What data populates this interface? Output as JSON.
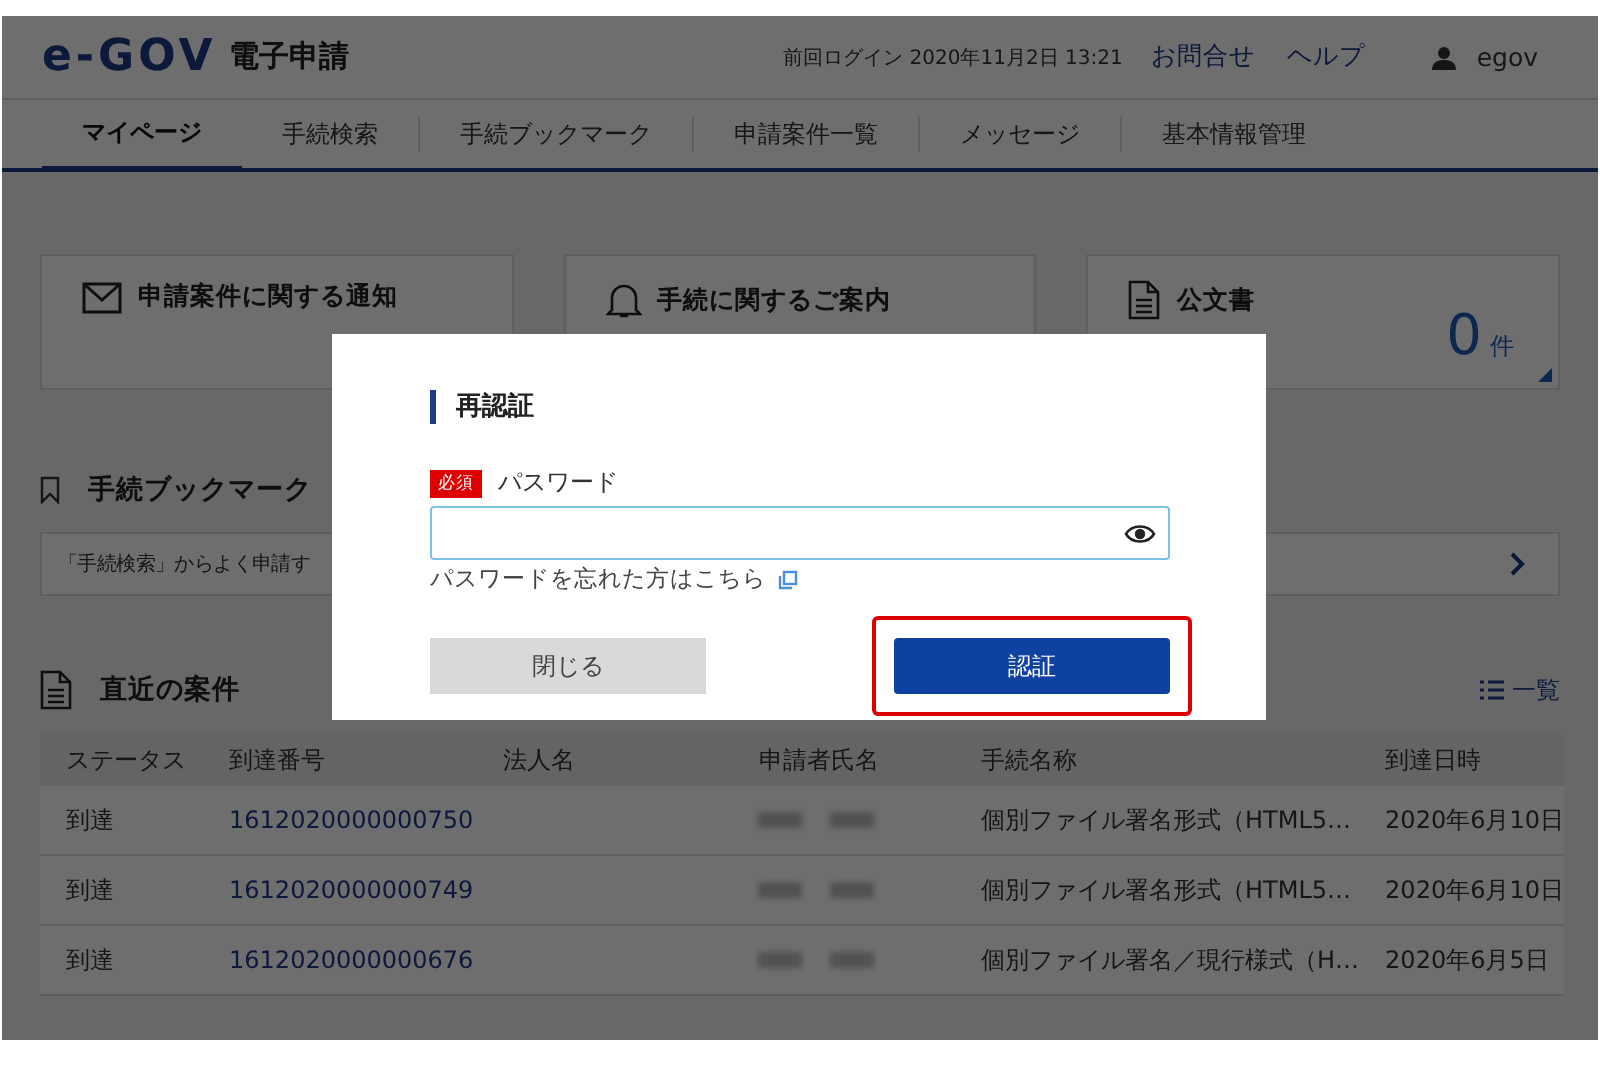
{
  "header": {
    "logo": "e-GOV",
    "service": "電子申請",
    "last_login": "前回ログイン 2020年11月2日 13:21",
    "links": [
      "お問合せ",
      "ヘルプ"
    ],
    "user": "egov"
  },
  "nav": [
    {
      "label": "マイページ",
      "selected": true
    },
    {
      "label": "手続検索",
      "selected": false
    },
    {
      "label": "手続ブックマーク",
      "selected": false
    },
    {
      "label": "申請案件一覧",
      "selected": false
    },
    {
      "label": "メッセージ",
      "selected": false
    },
    {
      "label": "基本情報管理",
      "selected": false
    }
  ],
  "cards": [
    {
      "kind": "mail",
      "title": "申請案件に関する通知"
    },
    {
      "kind": "bell",
      "title": "手続に関するご案内"
    },
    {
      "kind": "document",
      "title": "公文書",
      "count": "0",
      "unit": "件"
    }
  ],
  "bookmarks": {
    "title": "手続ブックマーク",
    "row": "「手続検索」からよく申請す"
  },
  "recent": {
    "title": "直近の案件",
    "list_link": "一覧",
    "columns": [
      "ステータス",
      "到達番号",
      "法人名",
      "申請者氏名",
      "手続名称",
      "到達日時"
    ],
    "rows": [
      {
        "status": "到達",
        "number": "1612020000000750",
        "procedure": "個別ファイル署名形式（HTML5…",
        "date": "2020年6月10日"
      },
      {
        "status": "到達",
        "number": "1612020000000749",
        "procedure": "個別ファイル署名形式（HTML5…",
        "date": "2020年6月10日"
      },
      {
        "status": "到達",
        "number": "1612020000000676",
        "procedure": "個別ファイル署名／現行様式（H…",
        "date": "2020年6月5日"
      }
    ]
  },
  "dialog": {
    "title": "再認証",
    "required": "必須",
    "label": "パスワード",
    "forgot": "パスワードを忘れた方はこちら",
    "buttons": [
      {
        "label": "閉じる",
        "kind": "secondary",
        "highlighted": false
      },
      {
        "label": "認証",
        "kind": "primary",
        "highlighted": true
      }
    ]
  }
}
